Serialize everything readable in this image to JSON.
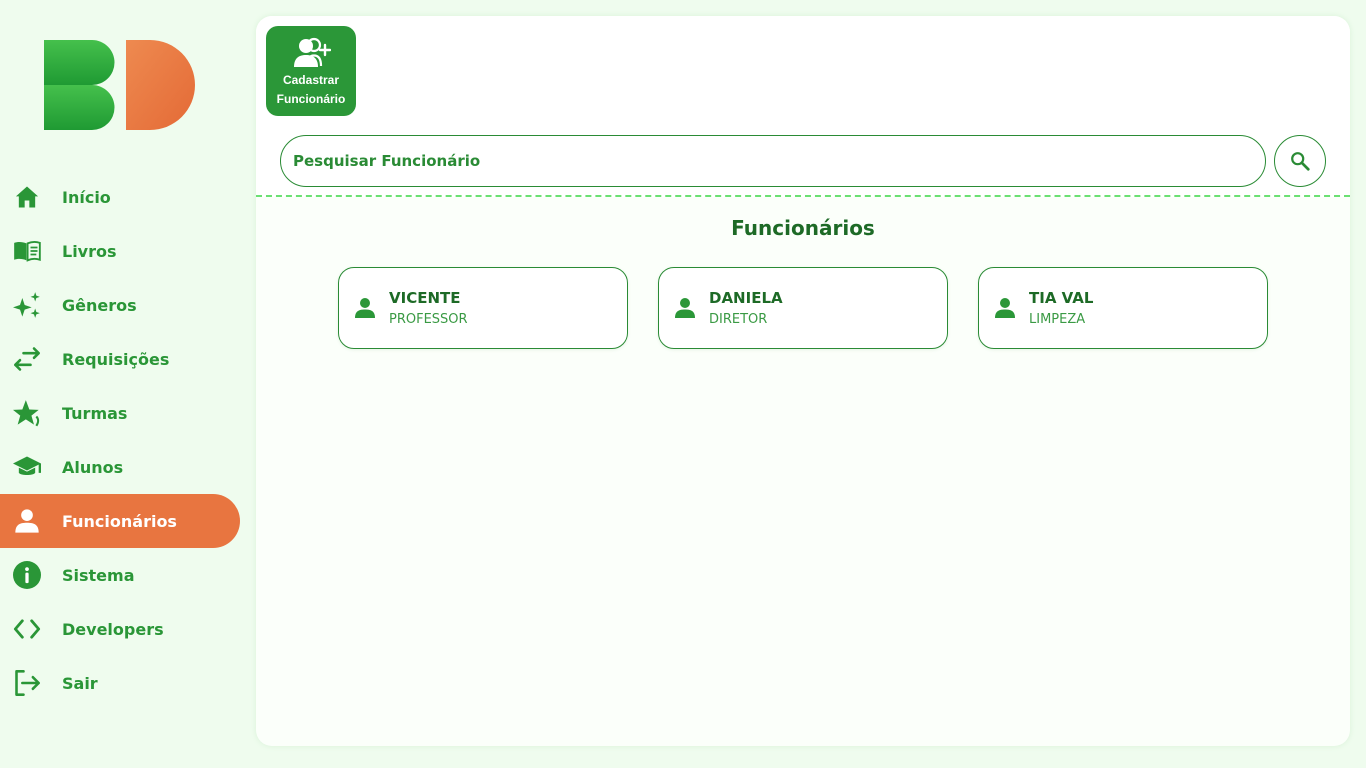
{
  "sidebar": {
    "logo": "BD",
    "items": [
      {
        "label": "Início",
        "icon": "home-icon",
        "active": false
      },
      {
        "label": "Livros",
        "icon": "book-icon",
        "active": false
      },
      {
        "label": "Gêneros",
        "icon": "sparkles-icon",
        "active": false
      },
      {
        "label": "Requisições",
        "icon": "swap-arrows-icon",
        "active": false
      },
      {
        "label": "Turmas",
        "icon": "star-icon",
        "active": false
      },
      {
        "label": "Alunos",
        "icon": "graduation-cap-icon",
        "active": false
      },
      {
        "label": "Funcionários",
        "icon": "person-icon",
        "active": true
      },
      {
        "label": "Sistema",
        "icon": "info-icon",
        "active": false
      },
      {
        "label": "Developers",
        "icon": "code-icon",
        "active": false
      },
      {
        "label": "Sair",
        "icon": "logout-icon",
        "active": false
      }
    ]
  },
  "toolbar": {
    "add_line1": "Cadastrar",
    "add_line2": "Funcionário",
    "add_icon": "add-users-icon"
  },
  "search": {
    "placeholder": "Pesquisar Funcionário",
    "button_icon": "search-icon"
  },
  "main": {
    "title": "Funcionários",
    "employees": [
      {
        "name": "VICENTE",
        "role": "PROFESSOR"
      },
      {
        "name": "DANIELA",
        "role": "DIRETOR"
      },
      {
        "name": "TIA VAL",
        "role": "LIMPEZA"
      }
    ]
  },
  "colors": {
    "primary_green": "#2b9738",
    "dark_green": "#1d6a26",
    "accent_orange": "#e87540",
    "background": "#effcee"
  }
}
